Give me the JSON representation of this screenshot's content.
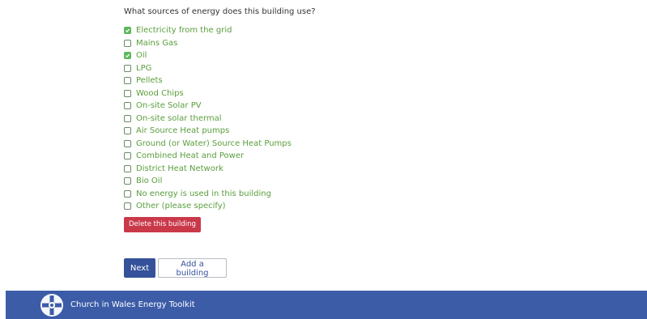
{
  "question": "What sources of energy does this building use?",
  "options": [
    {
      "label": "Electricity from the grid",
      "checked": true
    },
    {
      "label": "Mains Gas",
      "checked": false
    },
    {
      "label": "Oil",
      "checked": true
    },
    {
      "label": "LPG",
      "checked": false
    },
    {
      "label": "Pellets",
      "checked": false
    },
    {
      "label": "Wood Chips",
      "checked": false
    },
    {
      "label": "On-site Solar PV",
      "checked": false
    },
    {
      "label": "On-site solar thermal",
      "checked": false
    },
    {
      "label": "Air Source Heat pumps",
      "checked": false
    },
    {
      "label": "Ground (or Water) Source Heat Pumps",
      "checked": false
    },
    {
      "label": "Combined Heat and Power",
      "checked": false
    },
    {
      "label": "District Heat Network",
      "checked": false
    },
    {
      "label": "Bio Oil",
      "checked": false
    },
    {
      "label": "No energy is used in this building",
      "checked": false
    },
    {
      "label": "Other (please specify)",
      "checked": false
    }
  ],
  "actions": {
    "delete_label": "Delete this building",
    "next_label": "Next",
    "add_label": "Add a building"
  },
  "footer": {
    "brand": "Church in Wales Energy Toolkit",
    "logo_icon": "church-cross-logo-icon"
  },
  "colors": {
    "option_text": "#5a9e3c",
    "checked_box": "#5cb85c",
    "delete_button": "#c9394a",
    "primary": "#34519a",
    "footer_bg": "#3c5ca8"
  }
}
